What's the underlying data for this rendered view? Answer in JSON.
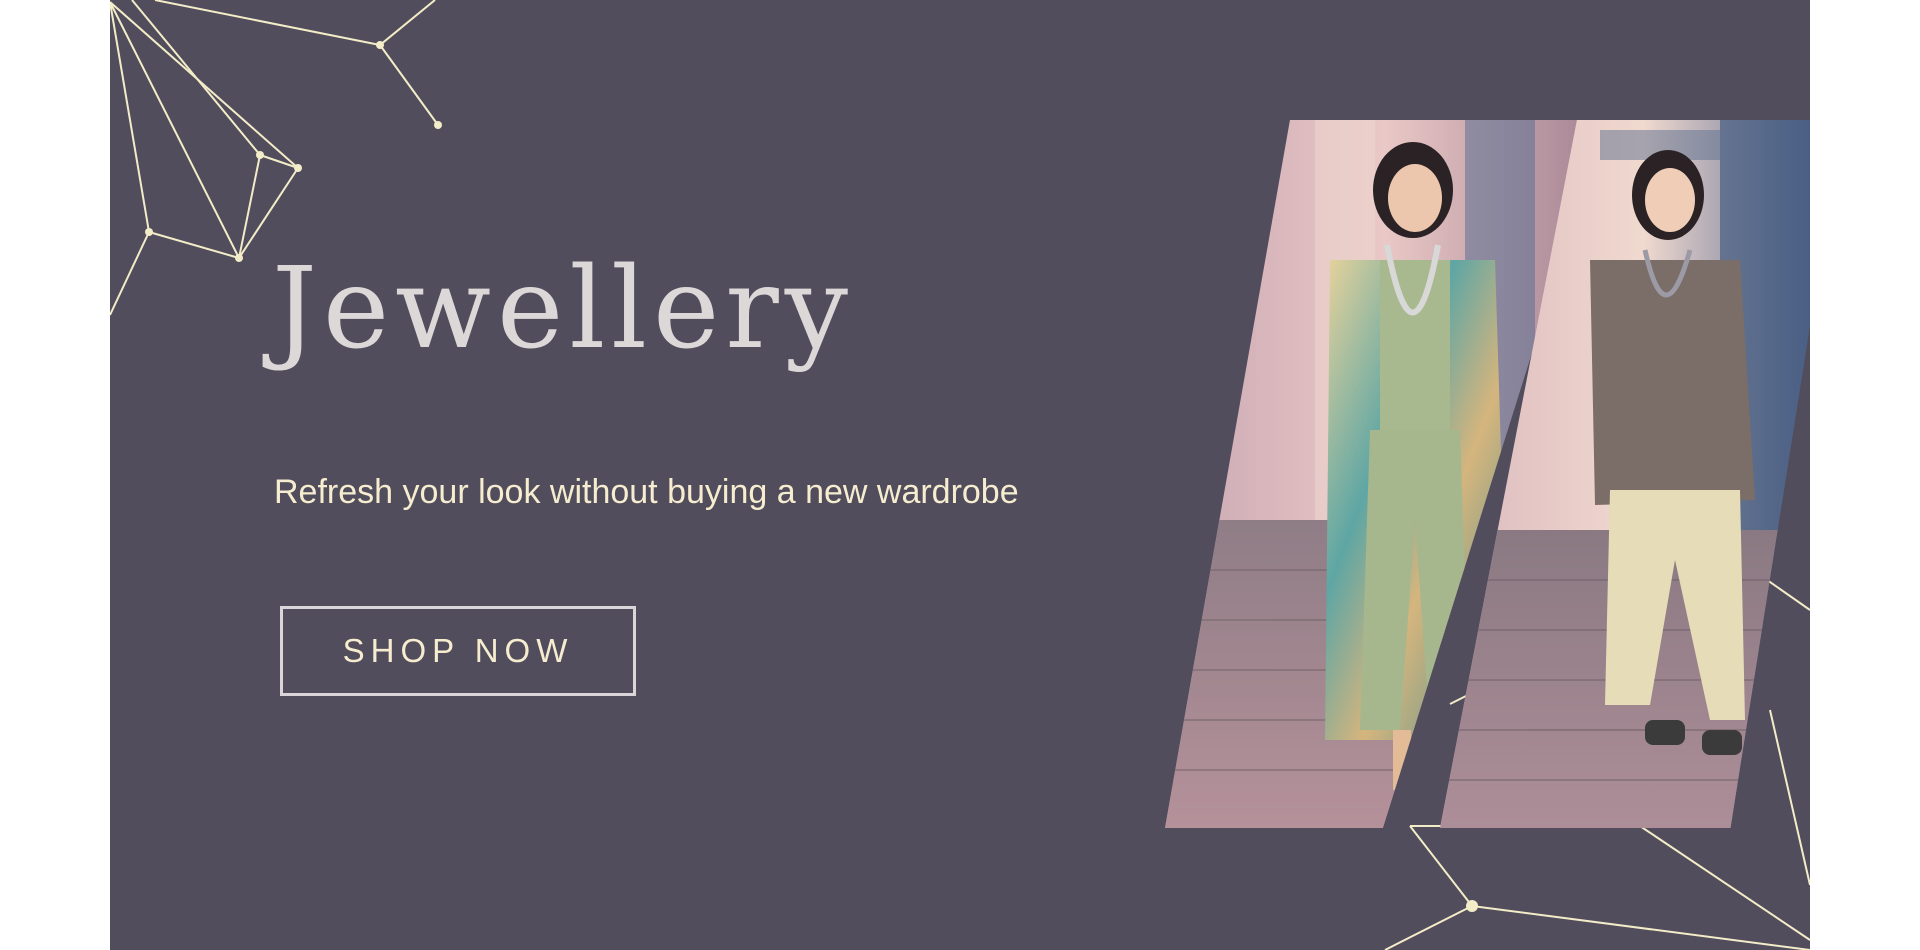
{
  "hero": {
    "title": "Jewellery",
    "tagline": "Refresh your look without buying a new wardrobe",
    "cta_label": "SHOP NOW"
  },
  "colors": {
    "page_background": "#ffffff",
    "banner_background": "#514d5c",
    "title_text": "#dcd8d8",
    "accent_cream": "#f6eccf",
    "button_border": "#d9d5d8",
    "constellation_line": "#f3ecc8"
  },
  "images": [
    {
      "name": "model-kimono-photo",
      "icon": "photo-woman-green-outfit-floral-kimono"
    },
    {
      "name": "model-brown-top-photo",
      "icon": "photo-woman-brown-top-cream-trousers"
    }
  ],
  "decorations": {
    "top_left": "constellation-lines-icon",
    "bottom_right": "constellation-lines-icon"
  }
}
